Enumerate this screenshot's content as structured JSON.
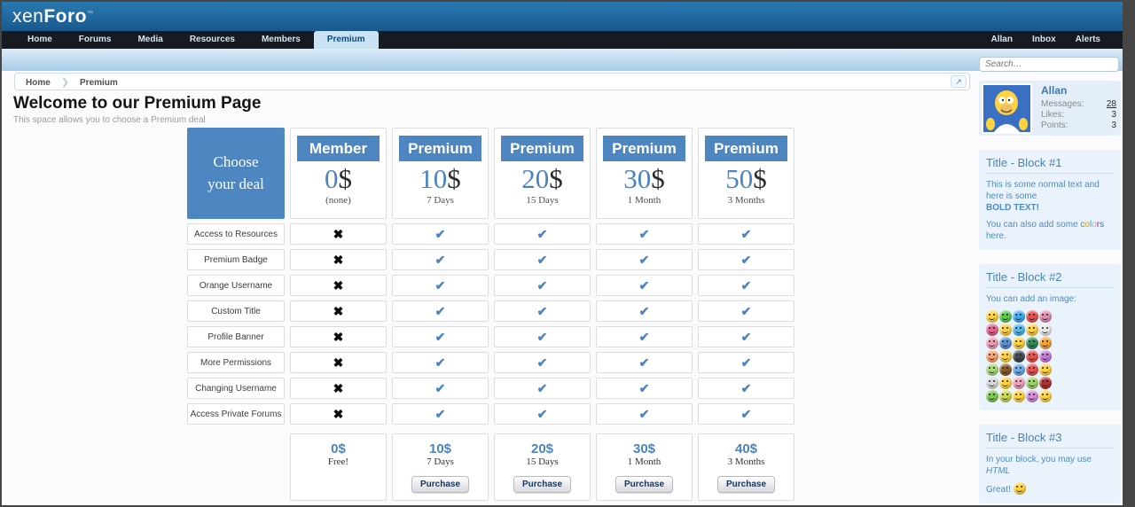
{
  "brand": {
    "logo_light": "xen",
    "logo_bold": "Foro",
    "logo_tm": "™"
  },
  "nav": {
    "items": [
      "Home",
      "Forums",
      "Media",
      "Resources",
      "Members",
      "Premium"
    ],
    "selected": "Premium",
    "user_links": [
      "Allan",
      "Inbox",
      "Alerts"
    ]
  },
  "breadcrumb": {
    "items": [
      "Home",
      "Premium"
    ],
    "expand_icon": "↗"
  },
  "page": {
    "title": "Welcome to our Premium Page",
    "subtitle": "This space allows you to choose a Premium deal"
  },
  "table": {
    "corner_title": "Choose your deal",
    "check_glyph": "✔",
    "cross_glyph": "✖",
    "features": [
      "Access to Resources",
      "Premium Badge",
      "Orange Username",
      "Custom Title",
      "Profile Banner",
      "More Permissions",
      "Changing Username",
      "Access Private Forums"
    ],
    "columns": [
      {
        "name": "Member",
        "price": "0",
        "currency": "$",
        "period": "(none)",
        "included": false,
        "footer_price": "0$",
        "footer_period": "Free!",
        "purchase_label": null
      },
      {
        "name": "Premium",
        "price": "10",
        "currency": "$",
        "period": "7 Days",
        "included": true,
        "footer_price": "10$",
        "footer_period": "7 Days",
        "purchase_label": "Purchase"
      },
      {
        "name": "Premium",
        "price": "20",
        "currency": "$",
        "period": "15 Days",
        "included": true,
        "footer_price": "20$",
        "footer_period": "15 Days",
        "purchase_label": "Purchase"
      },
      {
        "name": "Premium",
        "price": "30",
        "currency": "$",
        "period": "1 Month",
        "included": true,
        "footer_price": "30$",
        "footer_period": "1 Month",
        "purchase_label": "Purchase"
      },
      {
        "name": "Premium",
        "price": "50",
        "currency": "$",
        "period": "3 Months",
        "included": true,
        "footer_price": "40$",
        "footer_period": "3 Months",
        "purchase_label": "Purchase"
      }
    ],
    "accent_color": "#4d86c1",
    "check_color": "#4a84c4"
  },
  "sidebar": {
    "search_placeholder": "Search…",
    "visitor": {
      "name": "Allan",
      "stats": [
        {
          "label": "Messages:",
          "value": "28",
          "link": true
        },
        {
          "label": "Likes:",
          "value": "3",
          "link": false
        },
        {
          "label": "Points:",
          "value": "3",
          "link": false
        }
      ]
    },
    "block1": {
      "title": "Title - Block #1",
      "line1": "This is some normal text and here is some",
      "bold_text": "BOLD TEXT!",
      "line2_pre": "You can also add some ",
      "colors_word": [
        {
          "ch": "c",
          "color": "#3aaa35"
        },
        {
          "ch": "o",
          "color": "#f39200"
        },
        {
          "ch": "l",
          "color": "#36a9e1"
        },
        {
          "ch": "o",
          "color": "#b2b2b2"
        },
        {
          "ch": "r",
          "color": "#e6007e"
        },
        {
          "ch": "s",
          "color": "#1d71b8"
        }
      ],
      "line2_post": " here."
    },
    "block2": {
      "title": "Title - Block #2",
      "text": "You can add an image:",
      "smiley_colors": [
        "#ffd23e",
        "#59c94f",
        "#3fa9f5",
        "#e8504f",
        "#e08bb0",
        "#e2638c",
        "#ffd23e",
        "#51b7e8",
        "#ffd23e",
        "#e8e8e8",
        "#f09bb0",
        "#5a8fd4",
        "#ffd23e",
        "#2e8b57",
        "#f7a233",
        "#f5a26f",
        "#ffd23e",
        "#444a54",
        "#e8504f",
        "#c77ad8",
        "#a8d878",
        "#8a5a2b",
        "#6aa9e8",
        "#e8504f",
        "#ffd23e",
        "#d8d8d8",
        "#ffd23e",
        "#f0a0b8",
        "#9fd468",
        "#b03030",
        "#7ec850",
        "#c8d84f",
        "#ffd23e",
        "#d88ad8",
        "#ffd23e"
      ]
    },
    "block3": {
      "title": "Title - Block #3",
      "line1_pre": "In your block, you may use ",
      "line1_em": "HTML",
      "line2": "Great!",
      "smiley_color": "#ffd23e"
    }
  }
}
